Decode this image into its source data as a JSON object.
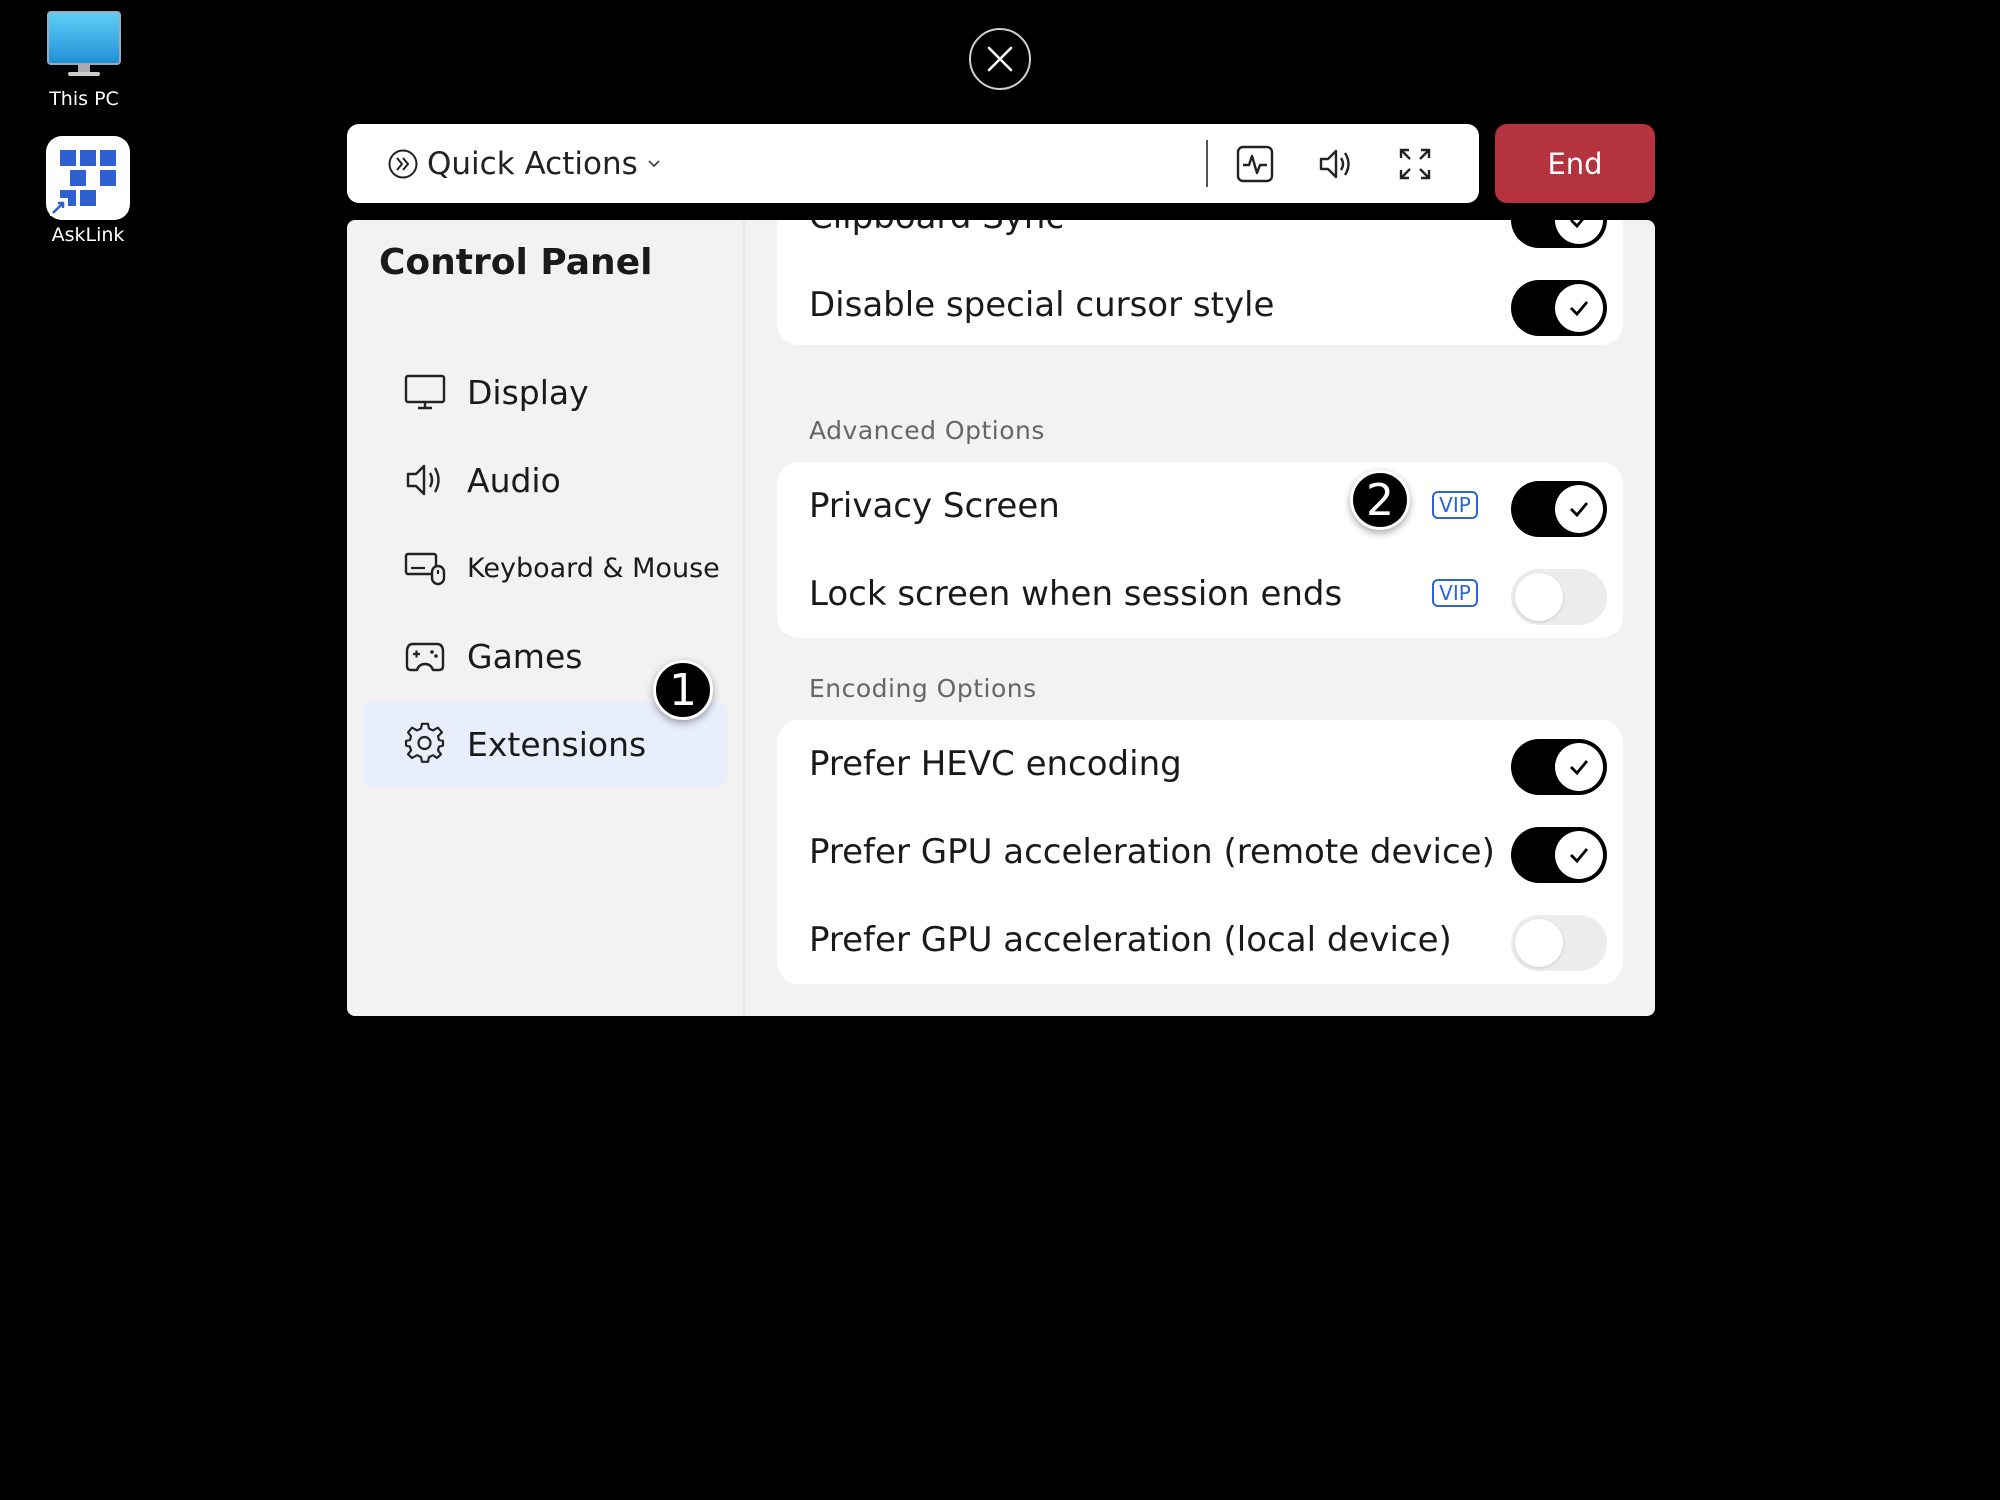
{
  "desktop": {
    "icons": [
      {
        "label": "This PC"
      },
      {
        "label": "AskLink"
      }
    ]
  },
  "toolbar": {
    "quick_actions_label": "Quick Actions",
    "end_label": "End",
    "icons": [
      "performance-monitor-icon",
      "speaker-icon",
      "fullscreen-icon"
    ]
  },
  "sidebar": {
    "title": "Control Panel",
    "items": [
      {
        "label": "Display",
        "icon": "monitor-icon"
      },
      {
        "label": "Audio",
        "icon": "speaker-icon"
      },
      {
        "label": "Keyboard & Mouse",
        "icon": "keyboard-mouse-icon"
      },
      {
        "label": "Games",
        "icon": "gamepad-icon"
      },
      {
        "label": "Extensions",
        "icon": "gear-icon",
        "selected": true
      }
    ]
  },
  "content": {
    "general": [
      {
        "label": "Clipboard Sync",
        "enabled": true
      },
      {
        "label": "Disable special cursor style",
        "enabled": true
      }
    ],
    "advanced": {
      "header": "Advanced Options",
      "items": [
        {
          "label": "Privacy Screen",
          "badge": "VIP",
          "enabled": true
        },
        {
          "label": "Lock screen when session ends",
          "badge": "VIP",
          "enabled": false
        }
      ]
    },
    "encoding": {
      "header": "Encoding Options",
      "items": [
        {
          "label": "Prefer HEVC encoding",
          "enabled": true
        },
        {
          "label": "Prefer GPU acceleration (remote device)",
          "enabled": true
        },
        {
          "label": "Prefer GPU acceleration (local device)",
          "enabled": false
        }
      ]
    }
  },
  "annotations": {
    "step1": "1",
    "step2": "2"
  },
  "colors": {
    "end_button": "#b5323f",
    "vip_badge": "#2b63d9",
    "selected_nav": "#e8eefc"
  }
}
